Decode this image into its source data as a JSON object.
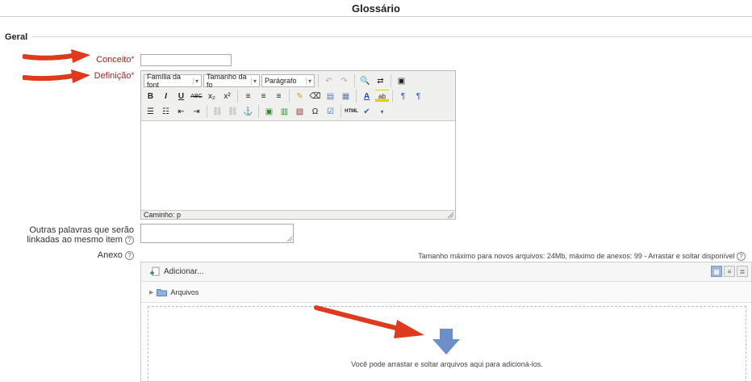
{
  "page": {
    "title": "Glossário"
  },
  "form": {
    "section_legend": "Geral",
    "concept_label": "Conceito",
    "definition_label": "Definição",
    "required_marker": "*",
    "aliases_label_line1": "Outras palavras que serão",
    "aliases_label_line2": "linkadas ao mesmo item",
    "attachment_label": "Anexo"
  },
  "editor": {
    "font_family_value": "Família da font",
    "font_size_value": "Tamanho da fo",
    "format_value": "Parágrafo",
    "path_label": "Caminho: p",
    "toolbar_row2": [
      "B",
      "I",
      "U",
      "ABC",
      "x₂",
      "x²",
      "≡",
      "≡",
      "≡",
      "✎",
      "⌫",
      "▤",
      "▦",
      "A",
      "ab",
      "¶",
      "¶"
    ],
    "toolbar_row3": [
      "☰",
      "☷",
      "⇤",
      "⇥",
      "⛓",
      "⛓",
      "⚑",
      "▣",
      "▥",
      "▧",
      "Ω",
      "☑",
      "HTML",
      "✔"
    ]
  },
  "filepicker": {
    "max_size_text": "Tamanho máximo para novos arquivos: 24Mb, máximo de anexos: 99 - Arrastar e soltar disponível",
    "add_label": "Adicionar...",
    "folder_label": "Arquivos",
    "drop_message": "Você pode arrastar e soltar arquivos aqui para adicioná-los."
  },
  "colors": {
    "required": "#aa2222",
    "annotation_arrow": "#e03a1e",
    "drop_arrow": "#6b8fc7"
  },
  "icons": {
    "help": "question-circle-icon",
    "add_file": "add-file-icon",
    "folder": "folder-icon",
    "expand": "triangle-right-icon",
    "drop": "arrow-down-icon"
  }
}
